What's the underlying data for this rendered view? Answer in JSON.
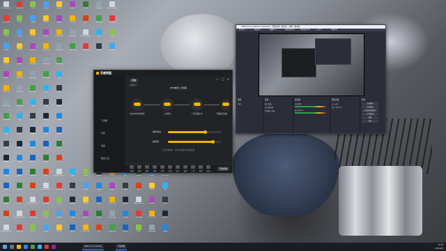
{
  "desktop": {
    "icons": [
      {
        "label": "Recycle Bin",
        "color": "#cfd6e0"
      },
      {
        "label": "YouTube",
        "color": "#e53935"
      },
      {
        "label": "Pics",
        "color": "#8bc34a"
      },
      {
        "label": "Video",
        "color": "#42a5f5"
      },
      {
        "label": "Docs",
        "color": "#ffca28"
      },
      {
        "label": "Music",
        "color": "#ab47bc"
      },
      {
        "label": "Chrome",
        "color": "#f4b400"
      },
      {
        "label": "Settings",
        "color": "#90a4ae"
      },
      {
        "label": "WeChat",
        "color": "#43a047"
      },
      {
        "label": "QQ",
        "color": "#29b6f6"
      },
      {
        "label": "OBS",
        "color": "#333a48"
      },
      {
        "label": "Steam",
        "color": "#1b2838"
      },
      {
        "label": "Edge",
        "color": "#1e88e5"
      },
      {
        "label": "Word",
        "color": "#1565c0"
      },
      {
        "label": "Excel",
        "color": "#2e7d32"
      },
      {
        "label": "PPT",
        "color": "#d84315"
      }
    ]
  },
  "app": {
    "logo": "百度网盘",
    "tab": "直播",
    "subtitle": "直播助手",
    "window_controls": [
      "—",
      "□",
      "✕"
    ],
    "sidebar": [
      "工具箱",
      "打开",
      "设置",
      "更多工具"
    ],
    "flow_title": "OBS推流二次直播",
    "steps": [
      {
        "label": "启动OBS软件推流"
      },
      {
        "label": "二次推流"
      },
      {
        "label": "打开直播平台"
      },
      {
        "label": "开始推流直播"
      }
    ],
    "rows": [
      {
        "label": "推流地址",
        "value": 70
      },
      {
        "label": "推流码",
        "value": 85
      }
    ],
    "hint": "点击开始推流，即可在直播平台看到画面",
    "bottom_items": [
      "直播",
      "美颜",
      "画质",
      "音效",
      "互动",
      "礼物",
      "更多",
      "设置",
      "工具",
      "帮助",
      "退出"
    ],
    "bottom_button": "开始直播"
  },
  "obs": {
    "title": "OBS 27.0.1 (64-bit, windows) - 配置文件: 未命名 - 场景: 未命名",
    "menu": [
      "文件(F)",
      "编辑(E)",
      "视图(V)",
      "配置文件(P)",
      "场景集合(S)",
      "工具(T)",
      "帮助(H)"
    ],
    "docks": {
      "scenes": {
        "title": "场景",
        "items": [
          "场景"
        ]
      },
      "sources": {
        "title": "来源",
        "items": [
          "窗口采集",
          "显示器采集",
          "音频输入采集"
        ]
      },
      "mixer": {
        "title": "混音器",
        "items": [
          "桌面音频",
          "麦克风/Aux"
        ]
      },
      "transitions": {
        "title": "场景过渡",
        "items": [
          "淡入淡出",
          "时长 300 ms"
        ]
      },
      "controls": {
        "title": "控件",
        "buttons": [
          "开始推流",
          "开始录制",
          "启动虚拟摄像机",
          "工作室模式",
          "设置",
          "退出"
        ]
      }
    }
  },
  "taskbar": {
    "apps": [
      "OBS 27.0.1 (64-bit)",
      "百度网盘"
    ],
    "tray_time": "15:33",
    "tray_date": "2021/9/3"
  }
}
